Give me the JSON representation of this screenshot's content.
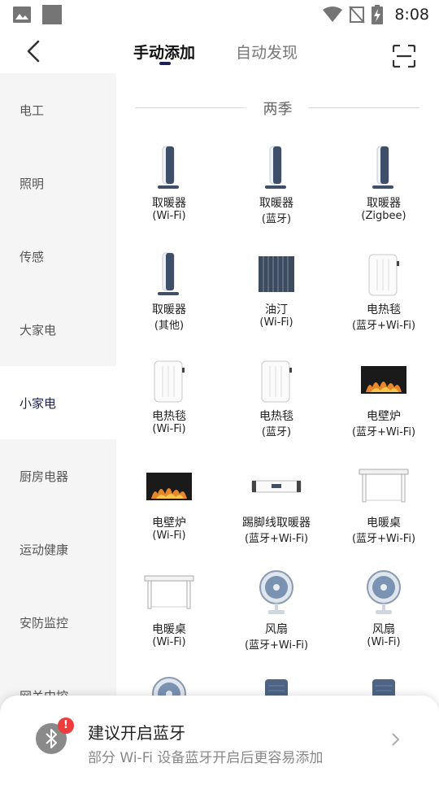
{
  "status_bar": {
    "time": "8:08"
  },
  "header": {
    "tabs": [
      {
        "label": "手动添加",
        "active": true
      },
      {
        "label": "自动发现",
        "active": false
      }
    ]
  },
  "sidebar": {
    "items": [
      {
        "label": "电工"
      },
      {
        "label": "照明"
      },
      {
        "label": "传感"
      },
      {
        "label": "大家电"
      },
      {
        "label": "小家电",
        "active": true
      },
      {
        "label": "厨房电器"
      },
      {
        "label": "运动健康"
      },
      {
        "label": "安防监控"
      },
      {
        "label": "网关中控"
      }
    ]
  },
  "section": {
    "title": "两季"
  },
  "devices": [
    {
      "name": "取暖器",
      "sub": "(Wi-Fi)",
      "icon": "heater-tower-icon"
    },
    {
      "name": "取暖器",
      "sub": "(蓝牙)",
      "icon": "heater-tower-icon"
    },
    {
      "name": "取暖器",
      "sub": "(Zigbee)",
      "icon": "heater-tower-icon"
    },
    {
      "name": "取暖器",
      "sub": "(其他)",
      "icon": "heater-tower-icon"
    },
    {
      "name": "油汀",
      "sub": "(Wi-Fi)",
      "icon": "oil-radiator-icon"
    },
    {
      "name": "电热毯",
      "sub": "(蓝牙+Wi-Fi)",
      "icon": "electric-blanket-icon"
    },
    {
      "name": "电热毯",
      "sub": "(Wi-Fi)",
      "icon": "electric-blanket-icon"
    },
    {
      "name": "电热毯",
      "sub": "(蓝牙)",
      "icon": "electric-blanket-icon"
    },
    {
      "name": "电壁炉",
      "sub": "(蓝牙+Wi-Fi)",
      "icon": "fireplace-icon"
    },
    {
      "name": "电壁炉",
      "sub": "(Wi-Fi)",
      "icon": "fireplace-icon"
    },
    {
      "name": "踢脚线取暖器",
      "sub": "(蓝牙+Wi-Fi)",
      "icon": "baseboard-heater-icon"
    },
    {
      "name": "电暖桌",
      "sub": "(蓝牙+Wi-Fi)",
      "icon": "heating-table-icon"
    },
    {
      "name": "电暖桌",
      "sub": "(Wi-Fi)",
      "icon": "heating-table-icon"
    },
    {
      "name": "风扇",
      "sub": "(蓝牙+Wi-Fi)",
      "icon": "fan-icon"
    },
    {
      "name": "风扇",
      "sub": "(Wi-Fi)",
      "icon": "fan-icon"
    },
    {
      "name": "",
      "sub": "",
      "icon": "fan-icon"
    },
    {
      "name": "",
      "sub": "",
      "icon": "air-purifier-icon"
    },
    {
      "name": "",
      "sub": "",
      "icon": "air-purifier-icon"
    }
  ],
  "banner": {
    "title": "建议开启蓝牙",
    "subtitle": "部分 Wi-Fi 设备蓝牙开启后更容易添加",
    "badge": "!"
  },
  "colors": {
    "accent": "#1b1f55",
    "sidebar_bg": "#f5f5f5",
    "badge": "#ef3b3b"
  }
}
